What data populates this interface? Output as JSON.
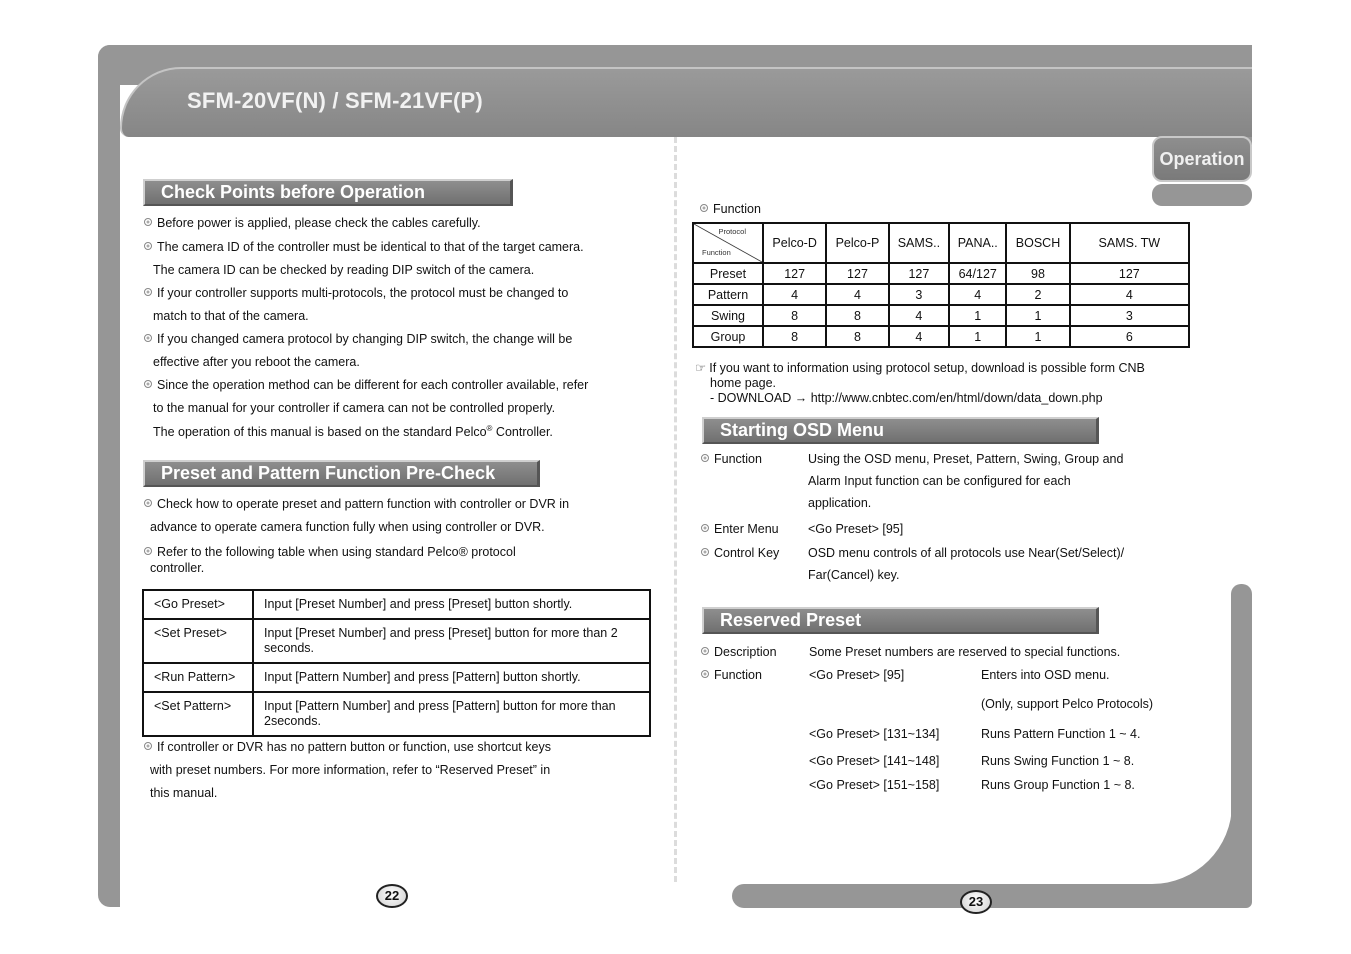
{
  "header": {
    "title": "SFM-20VF(N) / SFM-21VF(P)",
    "tab": "Operation"
  },
  "left": {
    "section1": {
      "title": "Check Points before Operation",
      "lines": [
        {
          "bullet": true,
          "text": "Before power is applied, please check the cables carefully."
        },
        {
          "bullet": true,
          "text": "The camera ID of the controller must be identical to that of the target camera."
        },
        {
          "bullet": false,
          "text": "The camera ID can be checked by reading DIP switch of the camera."
        },
        {
          "bullet": true,
          "text": "If your controller supports multi-protocols, the protocol must be changed to"
        },
        {
          "bullet": false,
          "text": "match  to that of the camera."
        },
        {
          "bullet": true,
          "text": "If you changed camera protocol by changing DIP switch, the change will be"
        },
        {
          "bullet": false,
          "text": "effective after you reboot the camera."
        },
        {
          "bullet": true,
          "text": "Since the operation method can be different for each controller available, refer"
        },
        {
          "bullet": false,
          "text": "to the manual for your controller if camera can not be controlled properly."
        }
      ],
      "last_line_pre": "The  operation of this manual is based on the standard Pelco",
      "last_line_sup": "®",
      "last_line_post": " Controller."
    },
    "section2": {
      "title": "Preset and Pattern Function Pre-Check",
      "lines": [
        "Check how to operate preset and pattern function with controller or DVR in",
        "advance  to operate camera function fully when using controller or DVR.",
        "Refer to the following table when using standard Pelco® protocol",
        "controller."
      ],
      "table": [
        {
          "key": "<Go Preset>",
          "value": "Input [Preset Number] and press [Preset] button shortly."
        },
        {
          "key": "<Set Preset>",
          "value": "Input [Preset Number] and press [Preset] button for more than 2 seconds."
        },
        {
          "key": "<Run Pattern>",
          "value": "Input [Pattern Number] and press [Pattern] button shortly."
        },
        {
          "key": "<Set Pattern>",
          "value": "Input [Pattern Number] and press [Pattern] button for more than 2seconds."
        }
      ],
      "note": [
        "If controller or DVR has no pattern button or function, use shortcut keys",
        "with preset numbers. For more information, refer to “Reserved Preset” in",
        "this manual."
      ]
    },
    "page_number": "22"
  },
  "right": {
    "function_label": "Function",
    "protocol_table": {
      "corner_protocol": "Protocol",
      "corner_function": "Function",
      "columns": [
        "Pelco-D",
        "Pelco-P",
        "SAMS..",
        "PANA..",
        "BOSCH",
        "SAMS. TW"
      ],
      "rows": [
        {
          "label": "Preset",
          "values": [
            "127",
            "127",
            "127",
            "64/127",
            "98",
            "127"
          ]
        },
        {
          "label": "Pattern",
          "values": [
            "4",
            "4",
            "3",
            "4",
            "2",
            "4"
          ]
        },
        {
          "label": "Swing",
          "values": [
            "8",
            "8",
            "4",
            "1",
            "1",
            "3"
          ]
        },
        {
          "label": "Group",
          "values": [
            "8",
            "8",
            "4",
            "1",
            "1",
            "6"
          ]
        }
      ]
    },
    "download_note": {
      "icon": "☞",
      "line1": "If you want to information using protocol setup, download is possible form CNB",
      "line2": "home page.",
      "line3": "- DOWNLOAD → http://www.cnbtec.com/en/html/down/data_down.php"
    },
    "osd": {
      "title": "Starting OSD Menu",
      "items": [
        {
          "label": "Function",
          "lines": [
            "Using the OSD menu, Preset, Pattern, Swing, Group and",
            "Alarm Input function can be configured for each",
            "application."
          ]
        },
        {
          "label": "Enter Menu",
          "lines": [
            "<Go Preset> [95]"
          ]
        },
        {
          "label": "Control Key",
          "lines": [
            "OSD menu controls of all protocols use Near(Set/Select)/",
            "Far(Cancel) key."
          ]
        }
      ]
    },
    "reserved": {
      "title": "Reserved Preset",
      "description_label": "Description",
      "description": "Some Preset numbers are reserved to special functions.",
      "function_label": "Function",
      "rows": [
        {
          "cmd": "<Go Preset> [95]",
          "desc": "Enters into OSD menu."
        },
        {
          "cmd": "",
          "desc": "(Only, support Pelco Protocols)"
        },
        {
          "cmd": "<Go Preset> [131~134]",
          "desc": "Runs Pattern Function 1 ~ 4."
        },
        {
          "cmd": "<Go Preset> [141~148]",
          "desc": "Runs Swing Function 1 ~ 8."
        },
        {
          "cmd": "<Go Preset> [151~158]",
          "desc": "Runs Group Function 1 ~ 8."
        }
      ]
    },
    "page_number": "23"
  }
}
